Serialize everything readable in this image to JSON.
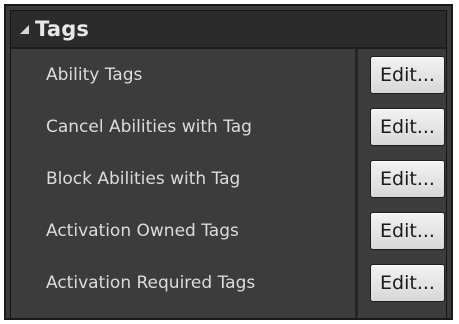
{
  "section": {
    "title": "Tags",
    "collapse_icon": "collapse-triangle-icon"
  },
  "rows": [
    {
      "label": "Ability Tags",
      "button_label": "Edit..."
    },
    {
      "label": "Cancel Abilities with Tag",
      "button_label": "Edit..."
    },
    {
      "label": "Block Abilities with Tag",
      "button_label": "Edit..."
    },
    {
      "label": "Activation Owned Tags",
      "button_label": "Edit..."
    },
    {
      "label": "Activation Required Tags",
      "button_label": "Edit..."
    }
  ],
  "colors": {
    "panel_background": "#3c3c3c",
    "header_background": "#2b2b2b",
    "label_text": "#dcdcdc",
    "button_background": "#e6e6e6"
  }
}
